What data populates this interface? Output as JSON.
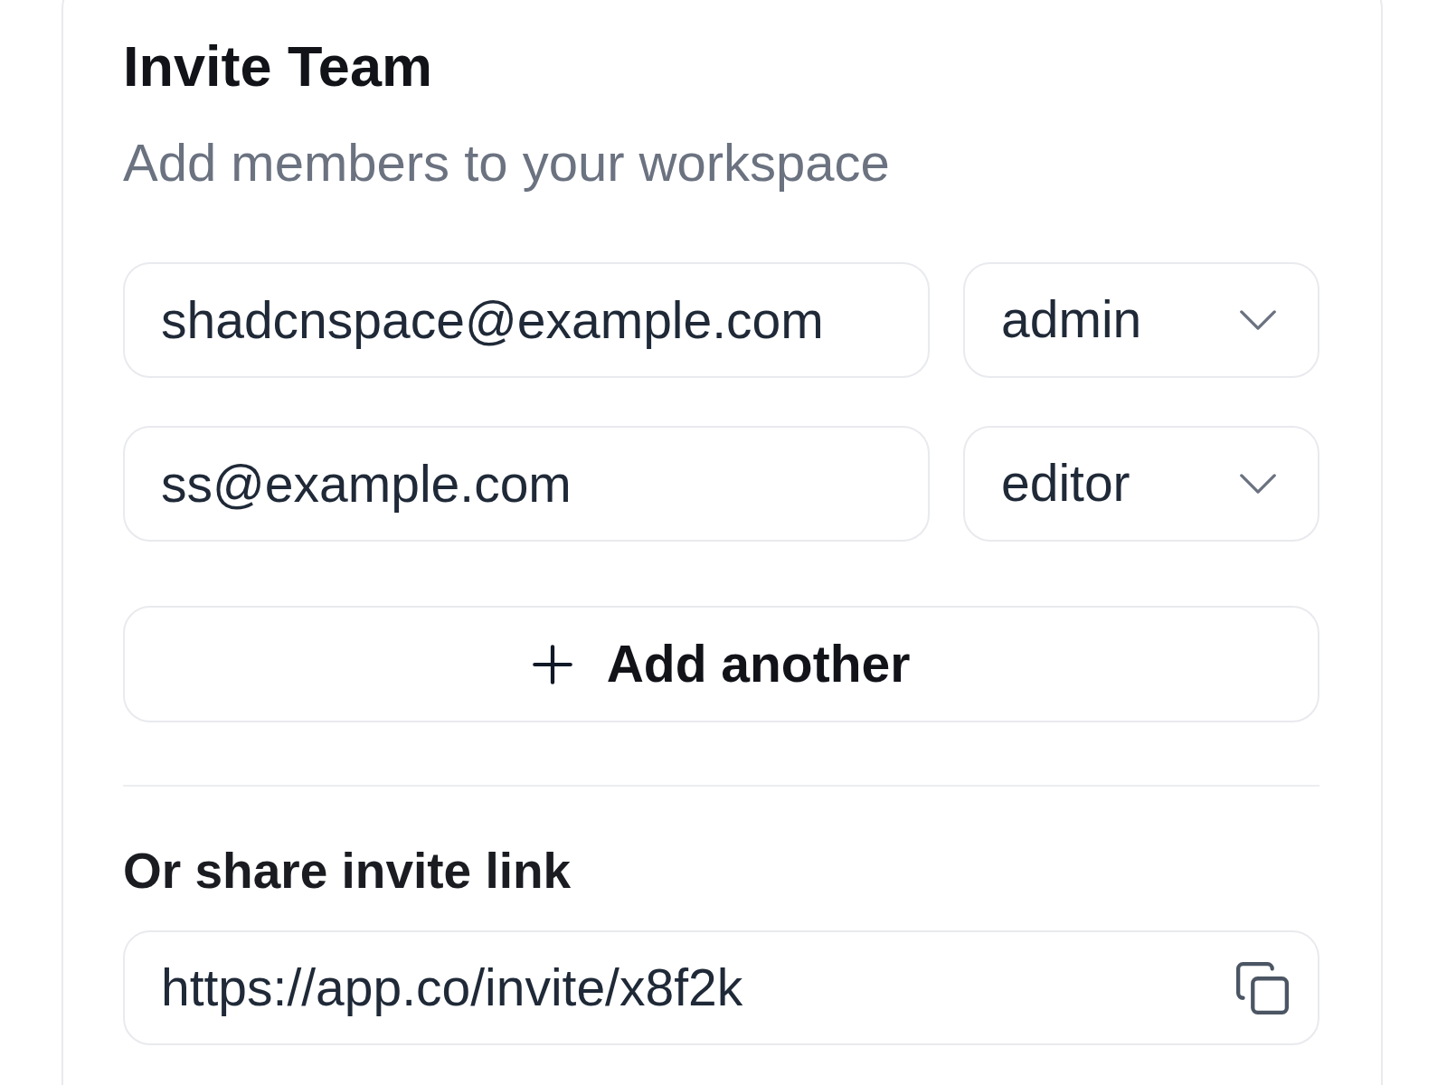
{
  "card": {
    "title": "Invite Team",
    "subtitle": "Add members to your workspace"
  },
  "invites": [
    {
      "email": "shadcnspace@example.com",
      "role": "admin"
    },
    {
      "email": "ss@example.com",
      "role": "editor"
    }
  ],
  "add_button": {
    "label": "Add another"
  },
  "share": {
    "heading": "Or share invite link",
    "link": "https://app.co/invite/x8f2k"
  }
}
